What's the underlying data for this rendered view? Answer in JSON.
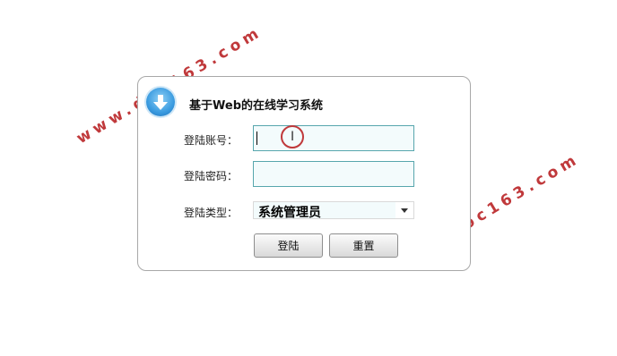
{
  "watermarks": [
    "www.doc163.com",
    "www.doc163.com"
  ],
  "login": {
    "title": "基于Web的在线学习系统",
    "username_label": "登陆账号：",
    "username_value": "",
    "password_label": "登陆密码：",
    "password_value": "",
    "type_label": "登陆类型：",
    "type_selected": "系统管理员",
    "login_button": "登陆",
    "reset_button": "重置"
  },
  "colors": {
    "watermark": "#c0393b",
    "field_border": "#57a6ad",
    "field_bg": "#f3fbfc",
    "logo": "#3a9be0"
  },
  "icons": [
    "download-arrow-icon",
    "chevron-down-icon",
    "text-cursor-icon"
  ]
}
